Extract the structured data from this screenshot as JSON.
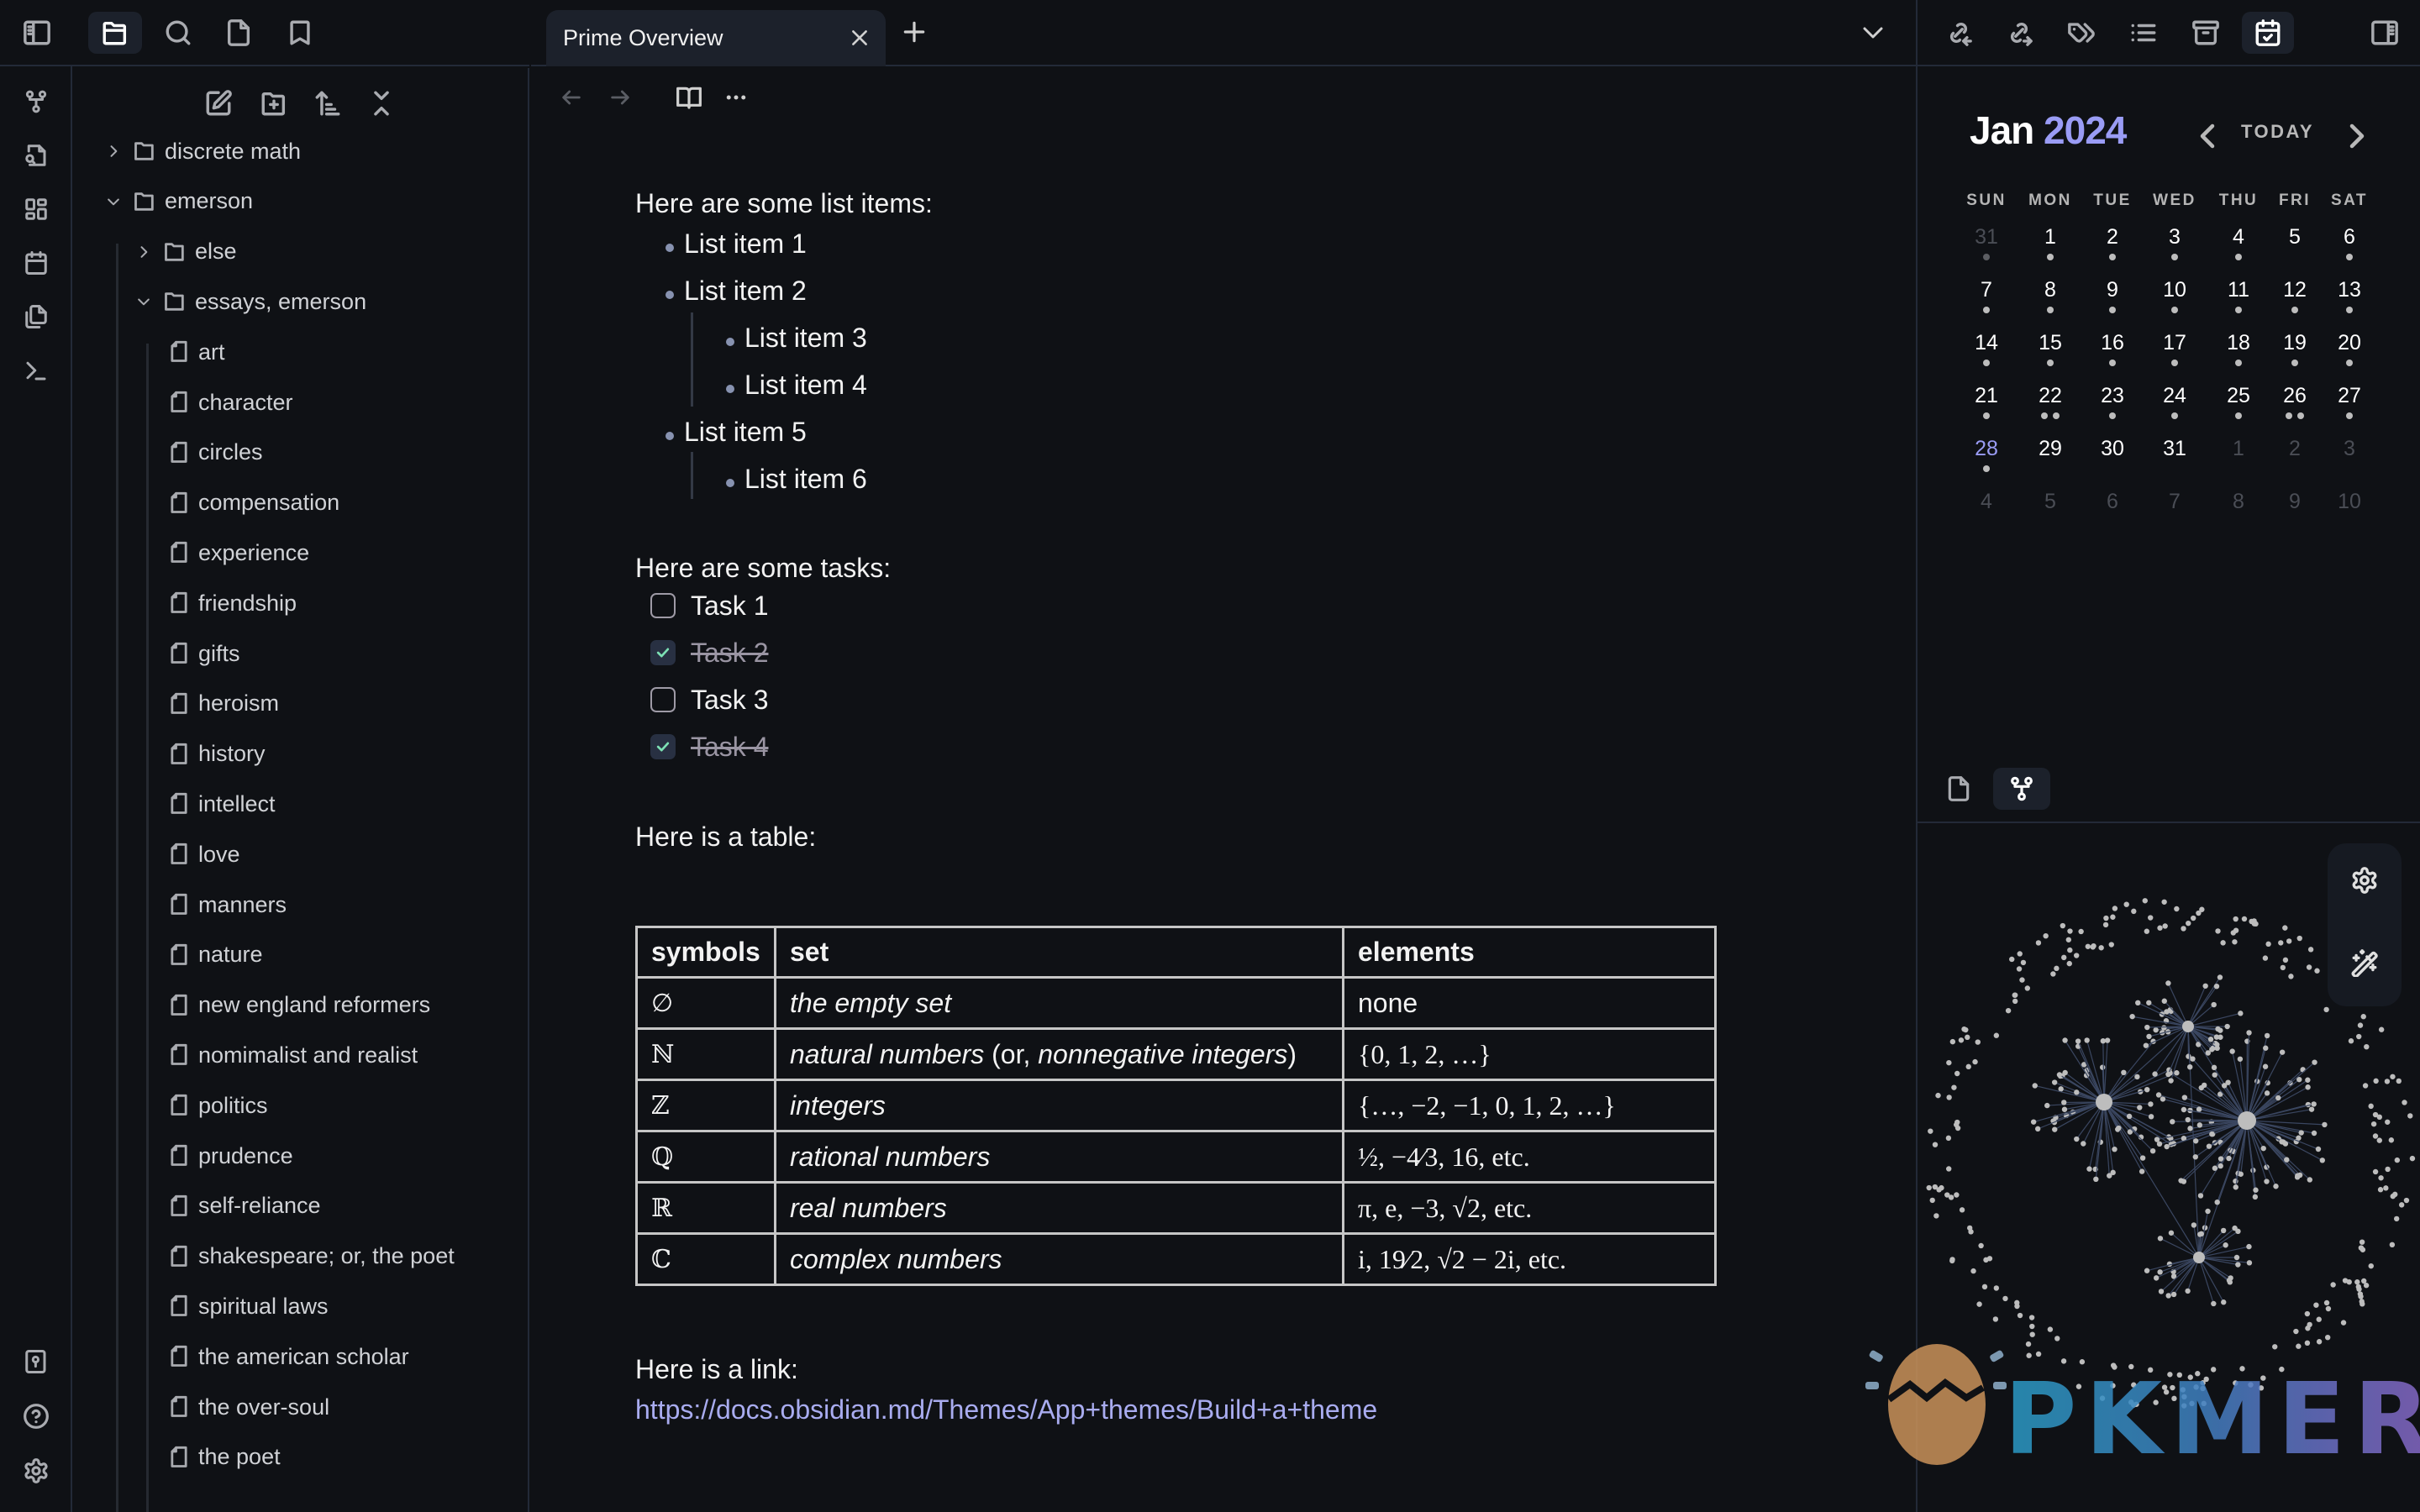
{
  "ribbon": {
    "top_icons": [
      "graph-icon",
      "file-search-icon",
      "layout-dashboard-icon",
      "calendar-icon",
      "files-icon",
      "terminal-icon"
    ],
    "bottom_icons": [
      "vault-icon",
      "help-icon",
      "settings-icon"
    ]
  },
  "left_sidebar": {
    "tabs": [
      {
        "name": "toggle-sidebar-icon",
        "active": false
      },
      {
        "name": "files-folder-icon",
        "active": true
      },
      {
        "name": "search-icon",
        "active": false
      },
      {
        "name": "file-icon",
        "active": false
      },
      {
        "name": "bookmark-icon",
        "active": false
      }
    ],
    "actions": [
      "new-note-icon",
      "new-folder-icon",
      "sort-icon",
      "collapse-all-icon"
    ],
    "tree": [
      {
        "label": "discrete math",
        "type": "folder",
        "depth": 0,
        "expanded": false
      },
      {
        "label": "emerson",
        "type": "folder",
        "depth": 0,
        "expanded": true
      },
      {
        "label": "else",
        "type": "folder",
        "depth": 1,
        "expanded": false
      },
      {
        "label": "essays, emerson",
        "type": "folder",
        "depth": 1,
        "expanded": true
      },
      {
        "label": "art",
        "type": "file",
        "depth": 2
      },
      {
        "label": "character",
        "type": "file",
        "depth": 2
      },
      {
        "label": "circles",
        "type": "file",
        "depth": 2
      },
      {
        "label": "compensation",
        "type": "file",
        "depth": 2
      },
      {
        "label": "experience",
        "type": "file",
        "depth": 2
      },
      {
        "label": "friendship",
        "type": "file",
        "depth": 2
      },
      {
        "label": "gifts",
        "type": "file",
        "depth": 2
      },
      {
        "label": "heroism",
        "type": "file",
        "depth": 2
      },
      {
        "label": "history",
        "type": "file",
        "depth": 2
      },
      {
        "label": "intellect",
        "type": "file",
        "depth": 2
      },
      {
        "label": "love",
        "type": "file",
        "depth": 2
      },
      {
        "label": "manners",
        "type": "file",
        "depth": 2
      },
      {
        "label": "nature",
        "type": "file",
        "depth": 2
      },
      {
        "label": "new england reformers",
        "type": "file",
        "depth": 2
      },
      {
        "label": "nomimalist and realist",
        "type": "file",
        "depth": 2
      },
      {
        "label": "politics",
        "type": "file",
        "depth": 2
      },
      {
        "label": "prudence",
        "type": "file",
        "depth": 2
      },
      {
        "label": "self-reliance",
        "type": "file",
        "depth": 2
      },
      {
        "label": "shakespeare; or, the poet",
        "type": "file",
        "depth": 2
      },
      {
        "label": "spiritual laws",
        "type": "file",
        "depth": 2
      },
      {
        "label": "the american scholar",
        "type": "file",
        "depth": 2
      },
      {
        "label": "the over-soul",
        "type": "file",
        "depth": 2
      },
      {
        "label": "the poet",
        "type": "file",
        "depth": 2
      }
    ]
  },
  "main": {
    "tab": {
      "title": "Prime Overview"
    },
    "list_heading": "Here are some list items:",
    "list_items": [
      {
        "text": "List item 1",
        "level": 0
      },
      {
        "text": "List item 2",
        "level": 0
      },
      {
        "text": "List item 3",
        "level": 1
      },
      {
        "text": "List item 4",
        "level": 1
      },
      {
        "text": "List item 5",
        "level": 0
      },
      {
        "text": "List item 6",
        "level": 1
      }
    ],
    "tasks_heading": "Here are some tasks:",
    "tasks": [
      {
        "text": "Task 1",
        "done": false
      },
      {
        "text": "Task 2",
        "done": true
      },
      {
        "text": "Task 3",
        "done": false
      },
      {
        "text": "Task 4",
        "done": true
      }
    ],
    "table_heading": "Here is a table:",
    "table": {
      "headers": [
        "symbols",
        "set",
        "elements"
      ],
      "rows": [
        {
          "symbol": "∅",
          "set": "the empty set",
          "set_extra": "",
          "set_extra2": "",
          "elements": "none"
        },
        {
          "symbol": "ℕ",
          "set": "natural numbers",
          "set_extra": " (or, ",
          "set_extra2": "nonnegative integers",
          "elements": "{0,  1,  2,  …}"
        },
        {
          "symbol": "ℤ",
          "set": "integers",
          "set_extra": "",
          "set_extra2": "",
          "elements": "{…,  −2,  −1,  0,  1,  2,  …}"
        },
        {
          "symbol": "ℚ",
          "set": "rational numbers",
          "set_extra": "",
          "set_extra2": "",
          "elements": "½,  −4⁄3,  16,  etc."
        },
        {
          "symbol": "ℝ",
          "set": "real numbers",
          "set_extra": "",
          "set_extra2": "",
          "elements": "π,  e,  −3,  √2,  etc."
        },
        {
          "symbol": "ℂ",
          "set": "complex numbers",
          "set_extra": "",
          "set_extra2": "",
          "elements": "i,  19⁄2,  √2 − 2i,  etc."
        }
      ]
    },
    "link_heading": "Here is a link:",
    "link": "https://docs.obsidian.md/Themes/App+themes/Build+a+theme"
  },
  "right_sidebar": {
    "tabs": [
      {
        "name": "backlinks-icon",
        "active": false
      },
      {
        "name": "outgoing-links-icon",
        "active": false
      },
      {
        "name": "tags-icon",
        "active": false
      },
      {
        "name": "outline-icon",
        "active": false
      },
      {
        "name": "archive-icon",
        "active": false
      },
      {
        "name": "calendar-check-icon",
        "active": true
      }
    ],
    "calendar": {
      "month": "Jan",
      "year": "2024",
      "today_label": "TODAY",
      "weekdays": [
        "SUN",
        "MON",
        "TUE",
        "WED",
        "THU",
        "FRI",
        "SAT"
      ],
      "weeks": [
        [
          {
            "d": "31",
            "o": true,
            "n": 1
          },
          {
            "d": "1",
            "n": 1
          },
          {
            "d": "2",
            "n": 1
          },
          {
            "d": "3",
            "n": 1
          },
          {
            "d": "4",
            "n": 1
          },
          {
            "d": "5",
            "n": 0
          },
          {
            "d": "6",
            "n": 1
          }
        ],
        [
          {
            "d": "7",
            "n": 1
          },
          {
            "d": "8",
            "n": 1
          },
          {
            "d": "9",
            "n": 1
          },
          {
            "d": "10",
            "n": 1
          },
          {
            "d": "11",
            "n": 1
          },
          {
            "d": "12",
            "n": 1
          },
          {
            "d": "13",
            "n": 1
          }
        ],
        [
          {
            "d": "14",
            "n": 1
          },
          {
            "d": "15",
            "n": 1
          },
          {
            "d": "16",
            "n": 1
          },
          {
            "d": "17",
            "n": 1
          },
          {
            "d": "18",
            "n": 1
          },
          {
            "d": "19",
            "n": 1
          },
          {
            "d": "20",
            "n": 1
          }
        ],
        [
          {
            "d": "21",
            "n": 1
          },
          {
            "d": "22",
            "n": 2
          },
          {
            "d": "23",
            "n": 1
          },
          {
            "d": "24",
            "n": 1
          },
          {
            "d": "25",
            "n": 1
          },
          {
            "d": "26",
            "n": 2
          },
          {
            "d": "27",
            "n": 1
          }
        ],
        [
          {
            "d": "28",
            "n": 1,
            "today": true
          },
          {
            "d": "29",
            "n": 0
          },
          {
            "d": "30",
            "n": 0
          },
          {
            "d": "31",
            "n": 0
          },
          {
            "d": "1",
            "o": true,
            "n": 0
          },
          {
            "d": "2",
            "o": true,
            "n": 0
          },
          {
            "d": "3",
            "o": true,
            "n": 0
          }
        ],
        [
          {
            "d": "4",
            "o": true,
            "n": 0
          },
          {
            "d": "5",
            "o": true,
            "n": 0
          },
          {
            "d": "6",
            "o": true,
            "n": 0
          },
          {
            "d": "7",
            "o": true,
            "n": 0
          },
          {
            "d": "8",
            "o": true,
            "n": 0
          },
          {
            "d": "9",
            "o": true,
            "n": 0
          },
          {
            "d": "10",
            "o": true,
            "n": 0
          }
        ]
      ]
    },
    "lower_tabs": [
      {
        "name": "file-icon",
        "active": false
      },
      {
        "name": "graph-icon",
        "active": true
      }
    ],
    "graph_controls": [
      "settings-icon",
      "magic-wand-icon"
    ]
  },
  "watermark": {
    "text": "PKMER"
  },
  "colors": {
    "accent": "#9a9cf5",
    "link": "#a9acf0",
    "checkmark": "#7ce0b4",
    "background": "#0f1115",
    "active_tab": "#1c212b",
    "border": "#232a38"
  }
}
